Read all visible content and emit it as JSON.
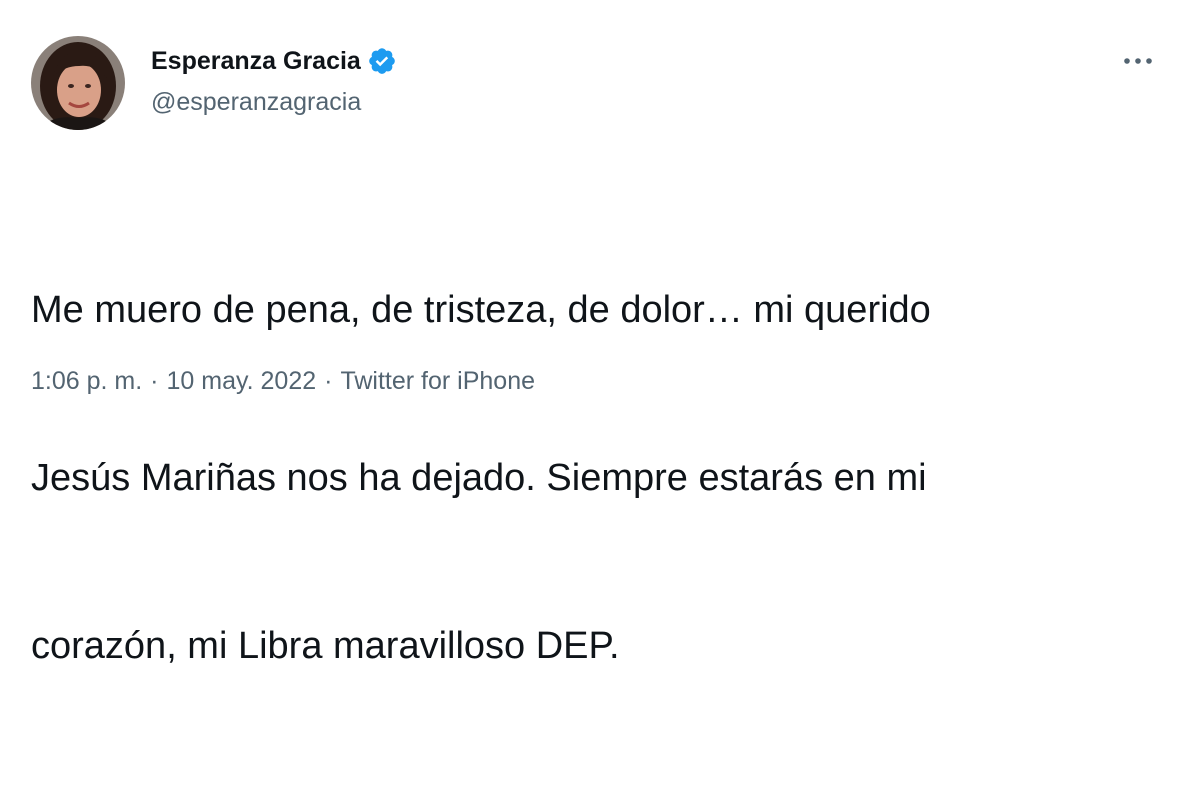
{
  "author": {
    "display_name": "Esperanza Gracia",
    "handle": "@esperanzagracia",
    "verified": true,
    "avatar_icon": "profile-photo",
    "verified_icon": "verified-badge-icon",
    "verified_color": "#1d9bf0"
  },
  "more_icon": "more-options-icon",
  "tweet": {
    "lines": [
      "Me muero de pena, de tristeza, de dolor… mi querido",
      "Jesús Mariñas nos ha dejado. Siempre estarás en mi",
      "corazón, mi Libra maravilloso DEP."
    ]
  },
  "meta": {
    "time": "1:06 p. m.",
    "separator": "·",
    "date": "10 may. 2022",
    "source": "Twitter for iPhone"
  },
  "colors": {
    "text": "#0f1419",
    "secondary": "#536471",
    "background": "#ffffff"
  }
}
